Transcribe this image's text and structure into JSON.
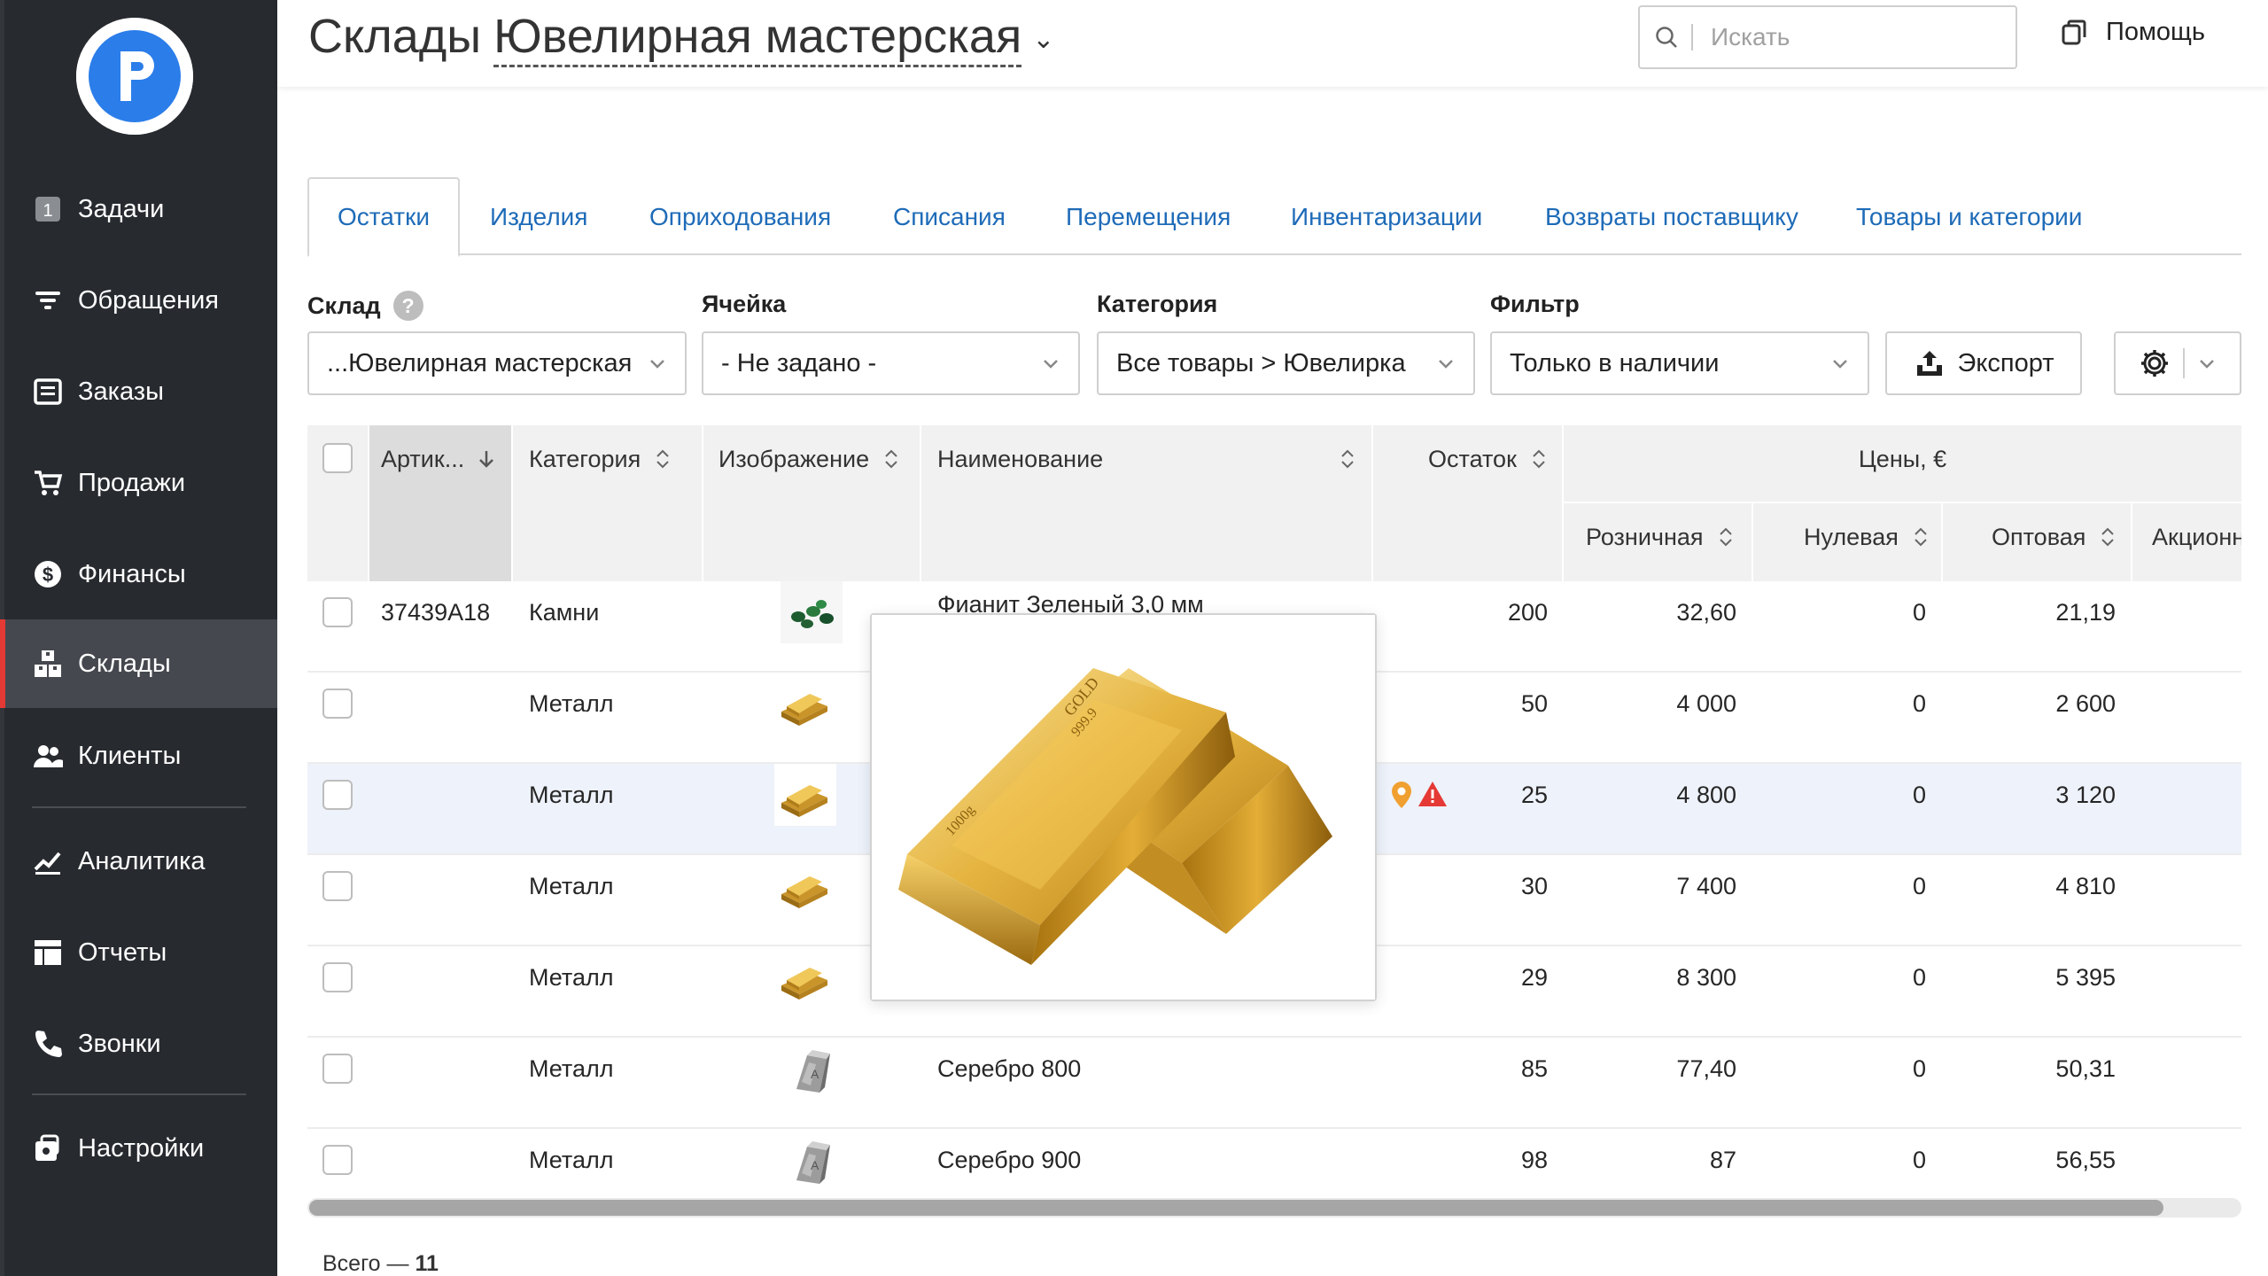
{
  "sidebar": {
    "items": [
      {
        "label": "Задачи",
        "icon": "tasks-icon",
        "badge": "1"
      },
      {
        "label": "Обращения",
        "icon": "filter-icon"
      },
      {
        "label": "Заказы",
        "icon": "orders-icon"
      },
      {
        "label": "Продажи",
        "icon": "cart-icon"
      },
      {
        "label": "Финансы",
        "icon": "dollar-icon"
      },
      {
        "label": "Склады",
        "icon": "warehouse-icon",
        "active": true
      },
      {
        "label": "Клиенты",
        "icon": "clients-icon"
      },
      {
        "label": "Аналитика",
        "icon": "analytics-icon"
      },
      {
        "label": "Отчеты",
        "icon": "reports-icon"
      },
      {
        "label": "Звонки",
        "icon": "phone-icon"
      },
      {
        "label": "Настройки",
        "icon": "settings-icon"
      }
    ]
  },
  "header": {
    "title": "Склады",
    "store": "Ювелирная мастерская",
    "search_placeholder": "Искать",
    "help": "Помощь"
  },
  "tabs": [
    "Остатки",
    "Изделия",
    "Оприходования",
    "Списания",
    "Перемещения",
    "Инвентаризации",
    "Возвраты поставщику",
    "Товары и категории"
  ],
  "filters": {
    "warehouse_label": "Склад",
    "warehouse_value": "...Ювелирная мастерская",
    "cell_label": "Ячейка",
    "cell_value": "- Не задано -",
    "category_label": "Категория",
    "category_value": "Все товары > Ювелирка",
    "filter_label": "Фильтр",
    "filter_value": "Только в наличии",
    "export": "Экспорт",
    "help_mark": "?"
  },
  "table": {
    "columns": {
      "article": "Артик...",
      "category": "Категория",
      "image": "Изображение",
      "name": "Наименование",
      "stock": "Остаток",
      "prices": "Цены, €",
      "retail": "Розничная",
      "zero": "Нулевая",
      "wholesale": "Оптовая",
      "promo": "Акционн"
    },
    "rows": [
      {
        "article": "37439A18",
        "category": "Камни",
        "name": "Фианит Зеленый 3,0 мм",
        "stock": "200",
        "retail": "32,60",
        "zero": "0",
        "wholesale": "21,19",
        "thumb": "green-stones"
      },
      {
        "article": "",
        "category": "Металл",
        "name": "",
        "stock": "50",
        "retail": "4 000",
        "zero": "0",
        "wholesale": "2 600",
        "thumb": "gold-bar"
      },
      {
        "article": "",
        "category": "Металл",
        "name": "",
        "stock": "25",
        "retail": "4 800",
        "zero": "0",
        "wholesale": "3 120",
        "thumb": "gold-bar",
        "highlight": true,
        "warning": true
      },
      {
        "article": "",
        "category": "Металл",
        "name": "",
        "stock": "30",
        "retail": "7 400",
        "zero": "0",
        "wholesale": "4 810",
        "thumb": "gold-bar"
      },
      {
        "article": "",
        "category": "Металл",
        "name": "",
        "stock": "29",
        "retail": "8 300",
        "zero": "0",
        "wholesale": "5 395",
        "thumb": "gold-bar"
      },
      {
        "article": "",
        "category": "Металл",
        "name": "Серебро 800",
        "stock": "85",
        "retail": "77,40",
        "zero": "0",
        "wholesale": "50,31",
        "thumb": "silver-bar"
      },
      {
        "article": "",
        "category": "Металл",
        "name": "Серебро 900",
        "stock": "98",
        "retail": "87",
        "zero": "0",
        "wholesale": "56,55",
        "thumb": "silver-bar"
      }
    ]
  },
  "footer": {
    "total_label": "Всего —",
    "total_value": "11"
  },
  "colors": {
    "sidebar": "#272a2f",
    "active_nav": "#45484e",
    "accent_red": "#e53935",
    "link_blue": "#1e6bb8",
    "logo_blue": "#2b7de9"
  }
}
